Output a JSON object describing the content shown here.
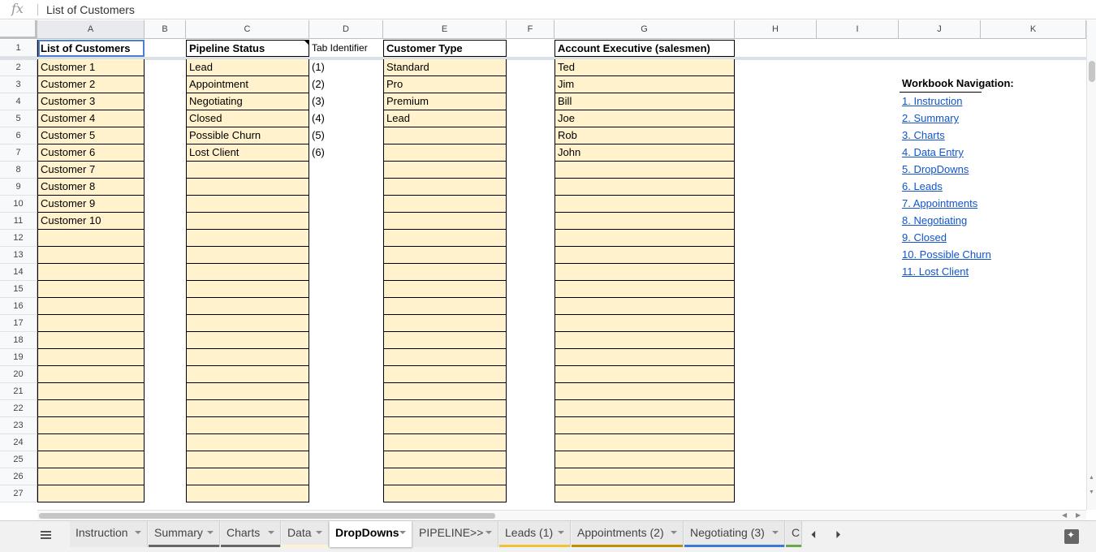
{
  "formula_bar": {
    "fx_label": "fx",
    "value": "List of Customers"
  },
  "columns": [
    "A",
    "B",
    "C",
    "D",
    "E",
    "F",
    "G",
    "H",
    "I",
    "J",
    "K"
  ],
  "rows": [
    "1",
    "2",
    "3",
    "4",
    "5",
    "6",
    "7",
    "8",
    "9",
    "10",
    "11",
    "12",
    "13",
    "14",
    "15",
    "16",
    "17",
    "18",
    "19",
    "20",
    "21",
    "22",
    "23",
    "24",
    "25",
    "26",
    "27"
  ],
  "headers": {
    "customers": "List of Customers",
    "pipeline": "Pipeline Status",
    "tab_id": "Tab Identifier",
    "customer_type": "Customer Type",
    "account_exec": "Account Executive (salesmen)"
  },
  "customers": [
    "Customer 1",
    "Customer 2",
    "Customer 3",
    "Customer 4",
    "Customer 5",
    "Customer 6",
    "Customer 7",
    "Customer 8",
    "Customer 9",
    "Customer 10"
  ],
  "pipeline_status": [
    "Lead",
    "Appointment",
    "Negotiating",
    "Closed",
    "Possible Churn",
    "Lost Client"
  ],
  "tab_identifiers": [
    "(1)",
    "(2)",
    "(3)",
    "(4)",
    "(5)",
    "(6)"
  ],
  "customer_types": [
    "Standard",
    "Pro",
    "Premium",
    "Lead"
  ],
  "account_execs": [
    "Ted",
    "Jim",
    "Bill",
    "Joe",
    "Rob",
    "John"
  ],
  "navigation": {
    "title": "Workbook Navigation:",
    "links": [
      "1. Instruction",
      "2. Summary",
      "3. Charts",
      "4. Data Entry",
      "5. DropDowns",
      "6. Leads",
      "7. Appointments",
      "8. Negotiating",
      "9. Closed",
      "10. Possible Churn",
      "11. Lost Client"
    ]
  },
  "sheet_tabs": [
    {
      "label": "Instruction",
      "color": ""
    },
    {
      "label": "Summary",
      "color": "#666666"
    },
    {
      "label": "Charts",
      "color": "#666666"
    },
    {
      "label": "Data",
      "color": "#fff2cc"
    },
    {
      "label": "DropDowns",
      "color": ""
    },
    {
      "label": "PIPELINE>>",
      "color": ""
    },
    {
      "label": "Leads (1)",
      "color": "#f1c232"
    },
    {
      "label": "Appointments (2)",
      "color": "#bf9000"
    },
    {
      "label": "Negotiating (3)",
      "color": "#3c78d8"
    },
    {
      "label": "C",
      "color": "#6aa84f"
    }
  ],
  "active_tab": "DropDowns",
  "colors": {
    "cell_fill": "#fff2cc",
    "link": "#1155cc",
    "selection": "#4a7fd4"
  }
}
